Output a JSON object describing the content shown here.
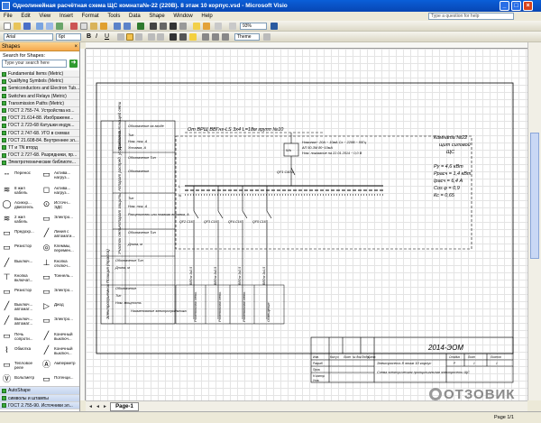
{
  "window": {
    "title": "Однолинейная расчётная схема ЩС комната№-22 (220В). 8 этаж 10 корпус.vsd - Microsoft Visio"
  },
  "menu": {
    "items": [
      "File",
      "Edit",
      "View",
      "Insert",
      "Format",
      "Tools",
      "Data",
      "Shape",
      "Window",
      "Help"
    ],
    "question": "Type a question for help"
  },
  "toolbar": {
    "font": "Arial",
    "size": "6pt",
    "zoom": "93%",
    "theme": "Theme"
  },
  "shapes_panel": {
    "title": "Shapes",
    "search_label": "Search for Shapes:",
    "search_placeholder": "Type your search here",
    "stencils": [
      "Fundamental Items (Metric)",
      "Qualifying Symbols (Metric)",
      "Semiconductors and Electron Tub...",
      "Switches and Relays (Metric)",
      "Transmission Paths (Metric)",
      "ГОСТ 2.755-74. Устройства ко...",
      "ГОСТ 21.614-88. Изображени...",
      "ГОСТ 2.723-68 Катушки индук...",
      "ГОСТ 2.747-68. УГО в схемах",
      "ГОСТ 21.608-84. Внутреннее эл...",
      "TT и TN вторд",
      "ГОСТ 2.727-68. Разрядники, пр...",
      "Электротехнические библиоте..."
    ],
    "shape_items": [
      "Перенос",
      "Актива... нагруз...",
      "8 жил кабель",
      "Актива... нагруз...",
      "Асинхр... двигатель",
      "Источн... ЭДС",
      "2 жил кабель",
      "Электро...",
      "Предохр...",
      "Линия с автомати...",
      "Резистор",
      "Клеммы, перемен...",
      "Выключ...",
      "Кнопка отключ...",
      "Кнопка включат...",
      "Тоннель...",
      "Резистор",
      "Электро...",
      "Выключ... автомат...",
      "Диод",
      "Выключ... автомат...",
      "Электро...",
      "Печь сопроти...",
      "Конечный выключ...",
      "Обмотка",
      "Конечный выключ...",
      "Тепловое реле",
      "Амперметр",
      "Вольтметр",
      "Потенци..."
    ],
    "bottom_stencils": [
      "AutoShape",
      "символы и штампы",
      "ГОСТ 2.755-90. Источники эл..."
    ]
  },
  "drawing": {
    "header_label": "От ВРЩ ВВГнг-LS 3х4 L=18м групп №10",
    "left_table": [
      "Данные питающей сети",
      "Аппарат распред. устройства",
      "Аппарат защиты",
      "Участок сети",
      "Позиция (трасса)",
      "Электроприемник"
    ],
    "left_table_lines": [
      "Обозначение на входе",
      "Тип",
      "Ном. ток, А",
      "Уставка, А",
      "Обозначение Тип",
      "Обозначение",
      "Тип",
      "Ном. ток, А",
      "Расцепитель или плавкая вставка, А",
      "Обозначение Тип",
      "Длина, м",
      "Обозначение Тип",
      "Длина, м",
      "Обозначение",
      "Тип",
      "Ном. мощность",
      "Наименование электроприёмника"
    ],
    "panel_info": [
      "Номинал~ 20А ~ 10мА Сх ~ 220В ~ 50Гц",
      "АП 50-3М 80~10мА",
      "Ном. показание на 22.01.2014 ~ 0,0 В"
    ],
    "room_info": [
      "Комната №22",
      "щит силовой",
      "ЩС",
      "Ру = 4,6 кВт",
      "Ррасч = 1,4 кВт",
      "Iрасч = 6,4 А",
      "Cos φ = 0,9",
      "Кс = 0,65"
    ],
    "breaker_labels": [
      "QF1 С40 А",
      "QF2 С16",
      "QF3 С16",
      "QF4 С16",
      "QF5 С16"
    ],
    "consumers": [
      "Розеточная сеть",
      "Розеточная сеть",
      "Розеточная сеть",
      "Освещение"
    ],
    "cable_labels": [
      "ВВГнг 3х2,5",
      "ВВГнг 3х2,5",
      "ВВГнг 3х2,5",
      "ВВГнг 3х1,5"
    ],
    "stamp_code": "2014-ЭОМ",
    "stamp_title": "Электросеть 8 этаж 10 корпус",
    "stamp_desc": "Схема электрическая принципиальная электросети ЩС",
    "stamp_small": [
      "Изм.",
      "Кол.уч",
      "Лист",
      "№ док.",
      "Подп.",
      "Дата",
      "Стадия",
      "Лист",
      "Листов",
      "Разраб.",
      "Пров.",
      "Н.контр.",
      "Утв.",
      "Р",
      "1",
      "1"
    ]
  },
  "status": {
    "page_tab": "Page-1",
    "page": "Page 1/1",
    "watermark": "ОТЗОВИК"
  }
}
